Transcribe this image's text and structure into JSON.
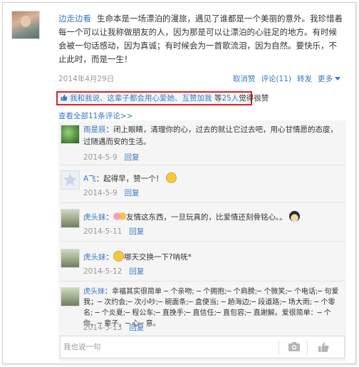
{
  "post": {
    "author": "边走边看",
    "text": "生命本是一场漂泊的漫旅，遇见了谁都是一个美丽的意外。我珍惜着每一个可以让我称做朋友的人，因为那是可以让漂泊的心驻足的地方。有时候会被一句话感动，因为真诚；有时候会为一首歌流泪，因为自然。要快乐，不止此时，而是一生！",
    "date": "2014年4月29日",
    "actions": {
      "unlike": "取消赞",
      "comment": "评论(11)",
      "share": "转发",
      "more": "更多"
    }
  },
  "likes": {
    "names": "我和我说、这辈子都会用心爱她、互赞加我",
    "middle": " 等",
    "count": "25人",
    "suffix": "觉得很赞"
  },
  "view_all": "查看全部11条评论>>",
  "comments": [
    {
      "author": "雨是辰",
      "text": "：闭上眼睛，清理你的心，过去的就让它过去吧，用心甘情愿的态度，过随遇而安的生活。",
      "date": "2014-5-9",
      "reply": "回复"
    },
    {
      "author": "A飞",
      "text": "：起得早，赞一个！",
      "date": "2014-5-9",
      "reply": "回复"
    },
    {
      "author": "虎头妹",
      "text_before": "：",
      "text": "友情这东西，一旦玩真的，比爱情还刻骨铭心。。",
      "date": "2014-5-11",
      "reply": "回复"
    },
    {
      "author": "虎头妹",
      "text_before": "：",
      "text": "哪天交换一下?呐呒*",
      "date": "2014-5-12",
      "reply": "回复"
    },
    {
      "author": "虎头妹",
      "text": "：幸福其实很简单 ─ 个亲吻; ─ 个拥抱;─ 个肩膀;─ 个微笑;─ 个电话;─ 句爱我；─ 次约会;─ 次小吵;─ 碗面条;─ 盒便当; ─ 趟海边;─ 段道路;─ 场大雨; ─ 个零名; ─ 个炎夏;─ 程公车;─ 直挽手;─ 直信任;─ 直包容;─ 直謝解。爱很简单：─ 个你，─ 辈子，─ 心─ 意。",
      "date": "2014-5-13",
      "reply": "回复"
    }
  ],
  "reply_box": {
    "placeholder": "我也说一句"
  },
  "icons": {
    "thumb": "thumbs-up-icon",
    "camera": "camera-icon",
    "like": "like-hand-icon"
  },
  "colors": {
    "link": "#3b78c2",
    "highlight_border": "#e02020",
    "muted": "#999999"
  }
}
